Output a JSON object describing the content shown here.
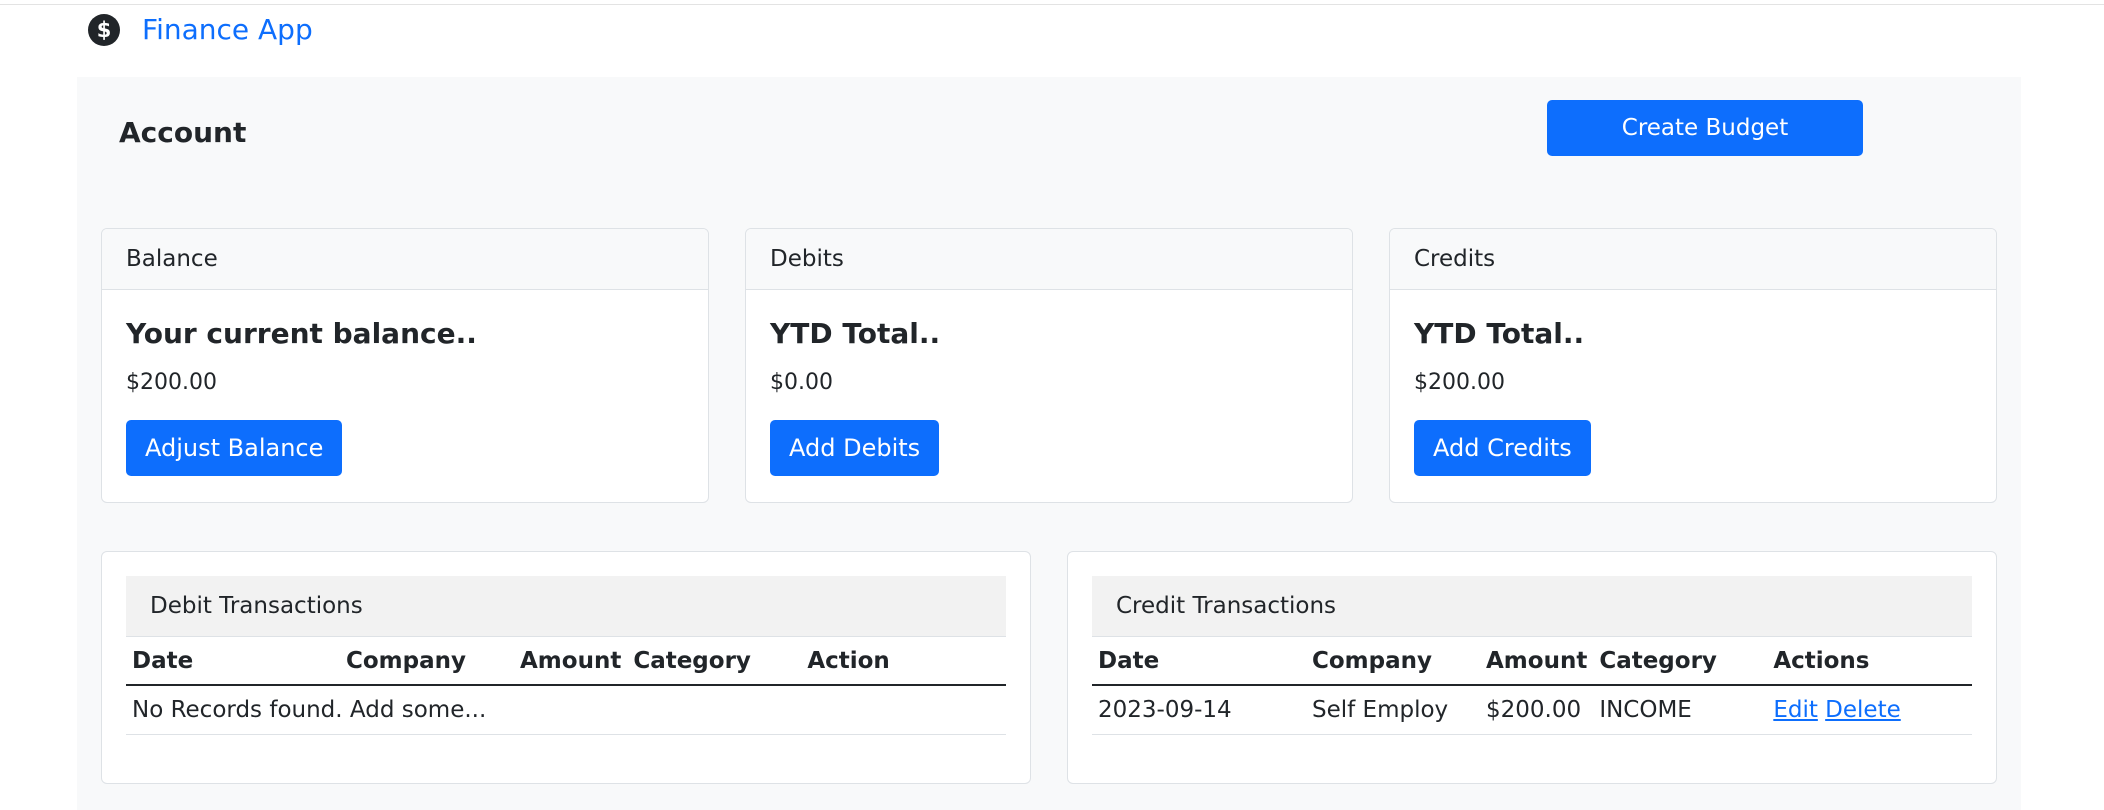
{
  "app": {
    "brand": "Finance App",
    "brand_icon": "dollar-circle-icon"
  },
  "colors": {
    "primary": "#0d6efd",
    "panel": "#f8f9fa",
    "text": "#212529"
  },
  "page": {
    "title": "Account",
    "create_budget_label": "Create Budget"
  },
  "cards": [
    {
      "header": "Balance",
      "title": "Your current balance..",
      "value": "$200.00",
      "button": "Adjust Balance"
    },
    {
      "header": "Debits",
      "title": "YTD Total..",
      "value": "$0.00",
      "button": "Add Debits"
    },
    {
      "header": "Credits",
      "title": "YTD Total..",
      "value": "$200.00",
      "button": "Add Credits"
    }
  ],
  "debit_table": {
    "title": "Debit Transactions",
    "columns": [
      "Date",
      "Company",
      "Amount",
      "Category",
      "Action"
    ],
    "empty_message": "No Records found. Add some..."
  },
  "credit_table": {
    "title": "Credit Transactions",
    "columns": [
      "Date",
      "Company",
      "Amount",
      "Category",
      "Actions"
    ],
    "rows": [
      {
        "date": "2023-09-14",
        "company": "Self Employ",
        "amount": "$200.00",
        "category": "INCOME",
        "edit": "Edit",
        "delete": "Delete"
      }
    ]
  }
}
